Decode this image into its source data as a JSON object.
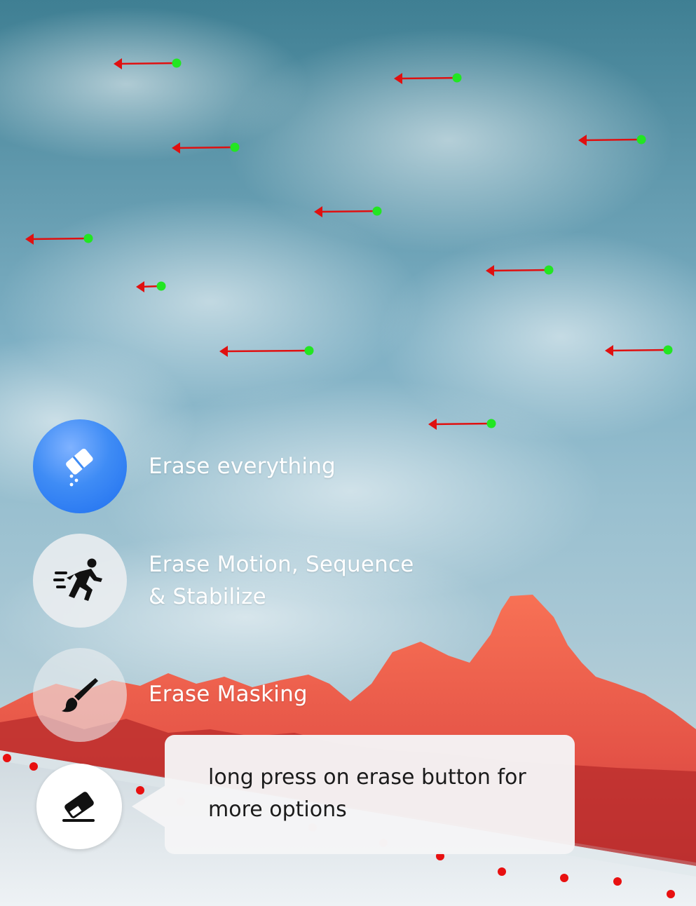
{
  "menu": {
    "items": [
      {
        "label": "Erase everything",
        "icon": "eraser-sparkle-icon"
      },
      {
        "label": "Erase Motion, Sequence",
        "label_line2": "& Stabilize",
        "icon": "running-person-icon"
      },
      {
        "label": "Erase Masking",
        "icon": "paintbrush-icon"
      }
    ],
    "main_button_icon": "eraser-icon"
  },
  "tooltip": {
    "line1": "long press on erase button for",
    "line2": "more options"
  },
  "colors": {
    "sky_top": "#3f7f93",
    "mask_red": "#e8291f",
    "motion_head": "#22e622",
    "motion_arrow": "#e01010",
    "accent_blue": "#1f6ff0"
  },
  "overlay": {
    "motion_vectors": [
      {
        "label": "motion-vector"
      }
    ]
  }
}
